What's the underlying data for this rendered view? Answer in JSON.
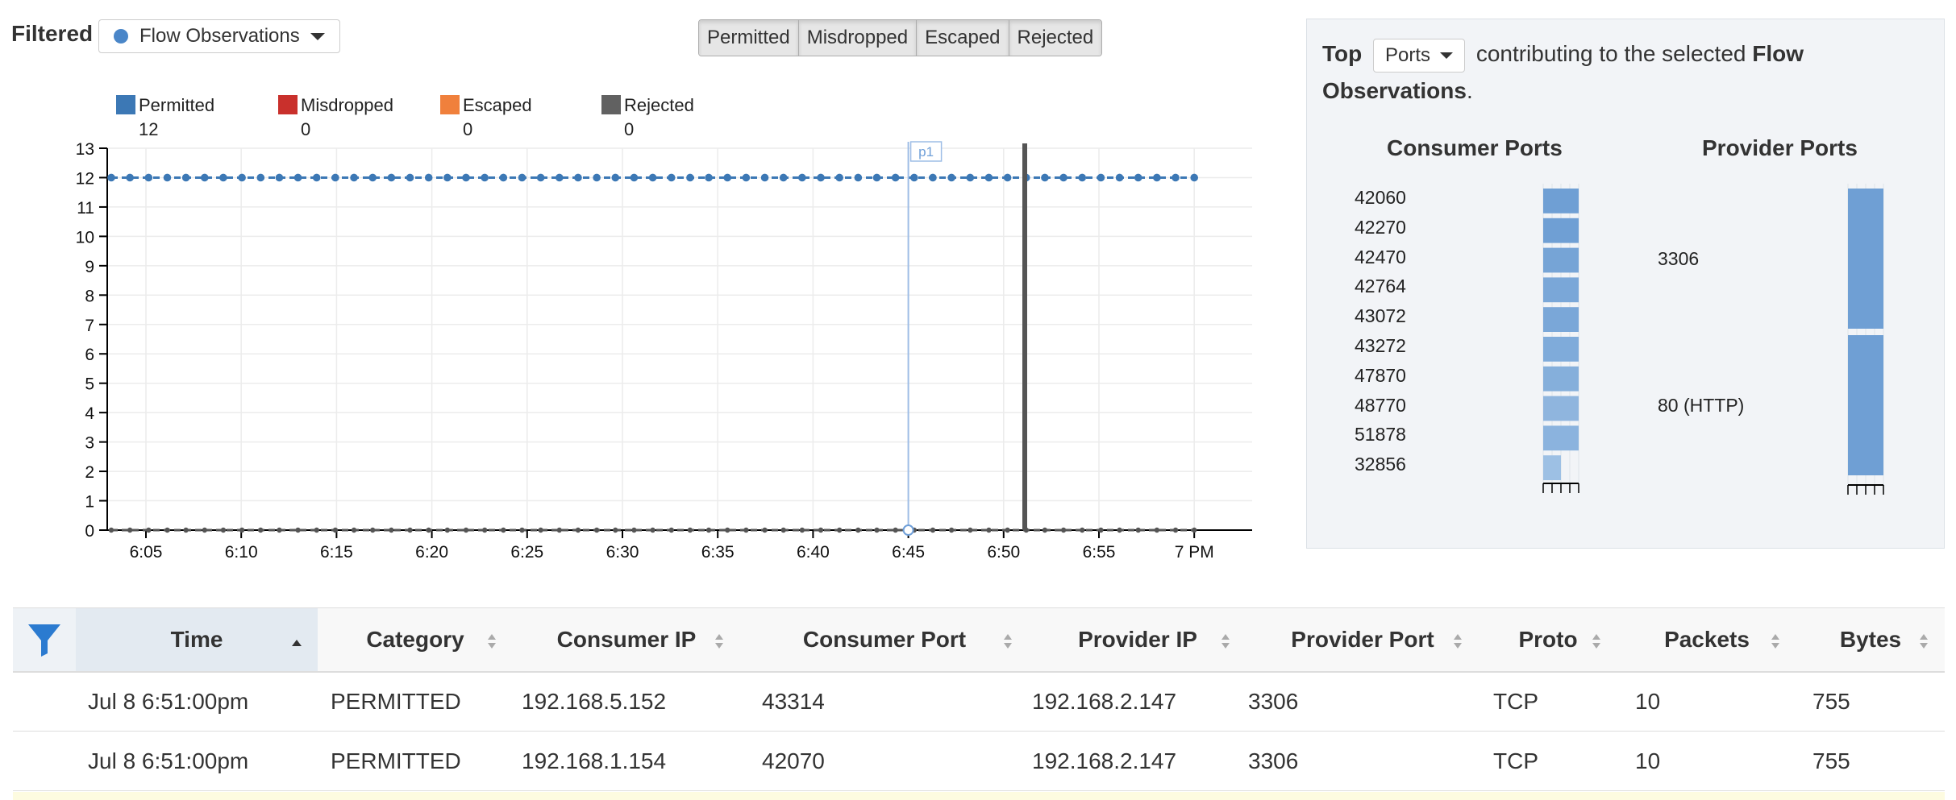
{
  "filter": {
    "label": "Filtered",
    "selected": "Flow Observations",
    "categories": [
      "Permitted",
      "Misdropped",
      "Escaped",
      "Rejected"
    ]
  },
  "legend": [
    {
      "name": "Permitted",
      "value": "12",
      "color": "#3c78b5"
    },
    {
      "name": "Misdropped",
      "value": "0",
      "color": "#c9302c"
    },
    {
      "name": "Escaped",
      "value": "0",
      "color": "#f0803c"
    },
    {
      "name": "Rejected",
      "value": "0",
      "color": "#616161"
    }
  ],
  "chart_data": {
    "type": "line",
    "y_ticks": [
      "0",
      "1",
      "2",
      "3",
      "4",
      "5",
      "6",
      "7",
      "8",
      "9",
      "10",
      "11",
      "12",
      "13"
    ],
    "ylim": [
      0,
      13
    ],
    "x_ticks": [
      "6:05",
      "6:10",
      "6:15",
      "6:20",
      "6:25",
      "6:30",
      "6:35",
      "6:40",
      "6:45",
      "6:50",
      "6:55",
      "7 PM"
    ],
    "series": [
      {
        "name": "Permitted",
        "values_constant": 12,
        "color": "#3c78b5"
      },
      {
        "name": "Rejected",
        "values_constant": 0,
        "color": "#555555"
      }
    ],
    "marker_label": "p1",
    "marker_time": "6:45",
    "grid": true
  },
  "top_panel": {
    "prefix": "Top",
    "select": "Ports",
    "middle": "contributing to the selected",
    "emph": "Flow Observations",
    "suffix": ".",
    "consumer_title": "Consumer Ports",
    "provider_title": "Provider Ports",
    "consumer_ports": [
      {
        "label": "42060",
        "value": 1.0
      },
      {
        "label": "42270",
        "value": 1.0
      },
      {
        "label": "42470",
        "value": 1.0
      },
      {
        "label": "42764",
        "value": 1.0
      },
      {
        "label": "43072",
        "value": 1.0
      },
      {
        "label": "43272",
        "value": 1.0
      },
      {
        "label": "47870",
        "value": 1.0
      },
      {
        "label": "48770",
        "value": 1.0
      },
      {
        "label": "51878",
        "value": 1.0
      },
      {
        "label": "32856",
        "value": 0.5
      }
    ],
    "provider_ports": [
      {
        "label": "3306",
        "share": 0.5
      },
      {
        "label": "80 (HTTP)",
        "share": 0.5
      }
    ]
  },
  "table": {
    "headers": [
      "Time",
      "Category",
      "Consumer IP",
      "Consumer Port",
      "Provider IP",
      "Provider Port",
      "Proto",
      "Packets",
      "Bytes"
    ],
    "rows": [
      [
        "Jul 8 6:51:00pm",
        "PERMITTED",
        "192.168.5.152",
        "43314",
        "192.168.2.147",
        "3306",
        "TCP",
        "10",
        "755"
      ],
      [
        "Jul 8 6:51:00pm",
        "PERMITTED",
        "192.168.1.154",
        "42070",
        "192.168.2.147",
        "3306",
        "TCP",
        "10",
        "755"
      ]
    ]
  }
}
